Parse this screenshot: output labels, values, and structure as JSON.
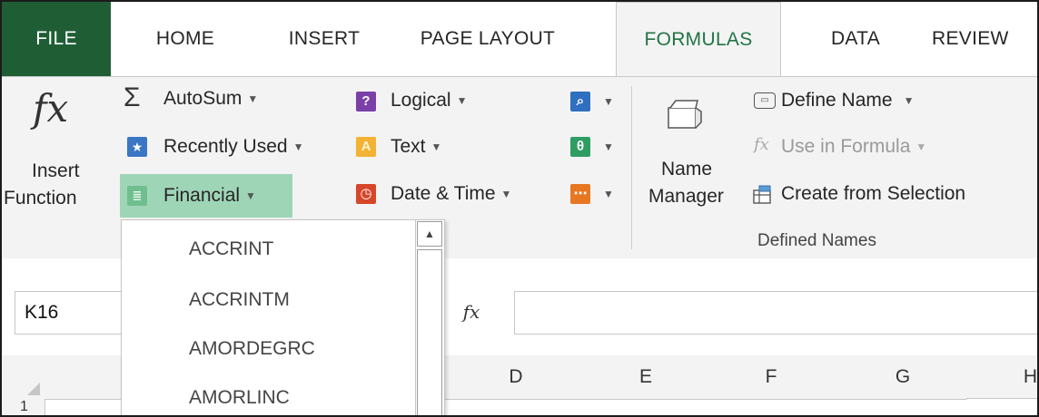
{
  "tabs": [
    {
      "label": "FILE"
    },
    {
      "label": "HOME"
    },
    {
      "label": "INSERT"
    },
    {
      "label": "PAGE LAYOUT"
    },
    {
      "label": "FORMULAS"
    },
    {
      "label": "DATA"
    },
    {
      "label": "REVIEW"
    }
  ],
  "ribbon": {
    "insert_function": {
      "line1": "Insert",
      "line2": "Function",
      "icon": "fx"
    },
    "autosum": "AutoSum",
    "recently_used": "Recently Used",
    "financial": "Financial",
    "logical": "Logical",
    "text": "Text",
    "date_time": "Date & Time",
    "name_manager": {
      "line1": "Name",
      "line2": "Manager"
    },
    "define_name": "Define Name",
    "use_in_formula": "Use in Formula",
    "create_from_selection": "Create from Selection",
    "defined_names_group": "Defined Names"
  },
  "dropdown": {
    "items": [
      "ACCRINT",
      "ACCRINTM",
      "AMORDEGRC",
      "AMORLINC"
    ]
  },
  "formula_bar": {
    "name_box": "K16",
    "fx": "fx"
  },
  "grid": {
    "columns": [
      "D",
      "E",
      "F",
      "G",
      "H"
    ],
    "rows": [
      "1"
    ]
  },
  "colors": {
    "accent": "#217346",
    "file_tab": "#1f5e35",
    "highlight": "#9fd5b7"
  }
}
